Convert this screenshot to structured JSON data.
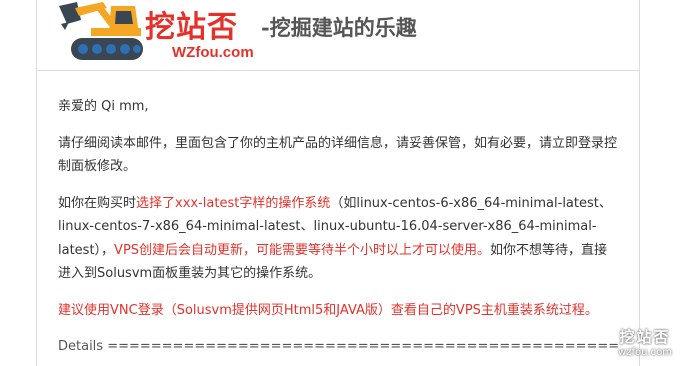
{
  "header": {
    "brand_cn": "挖站否",
    "brand_en": "WZfou.com",
    "slogan": "-挖掘建站的乐趣"
  },
  "email": {
    "greeting": "亲爱的 Qi mm,",
    "para1": "请仔细阅读本邮件，里面包含了你的主机产品的详细信息，请妥善保管，如有必要，请立即登录控制面板修改。",
    "para2": {
      "t1": "如你在购买时",
      "t2": "选择了xxx-latest字样的操作系统",
      "t3": "（如linux-centos-6-x86_64-minimal-latest、linux-centos-7-x86_64-minimal-latest、linux-ubuntu-16.04-server-x86_64-minimal-latest），",
      "t4": "VPS创建后会自动更新，可能需要等待半个小时以上才可以使用。",
      "t5": "如你不想等待，直接进入到Solusvm面板重装为其它的操作系统。"
    },
    "para3": "建议使用VNC登录（Solusvm提供网页Html5和JAVA版）查看自己的VPS主机重装系统过程。",
    "details": "Details ================================================================="
  },
  "watermark": {
    "cn": "挖站否",
    "en": "wzfou.com"
  },
  "colors": {
    "accent_red": "#e4322b",
    "logo_yellow": "#f5a623",
    "logo_dark": "#3a4652",
    "logo_blue": "#2f6fb3"
  }
}
